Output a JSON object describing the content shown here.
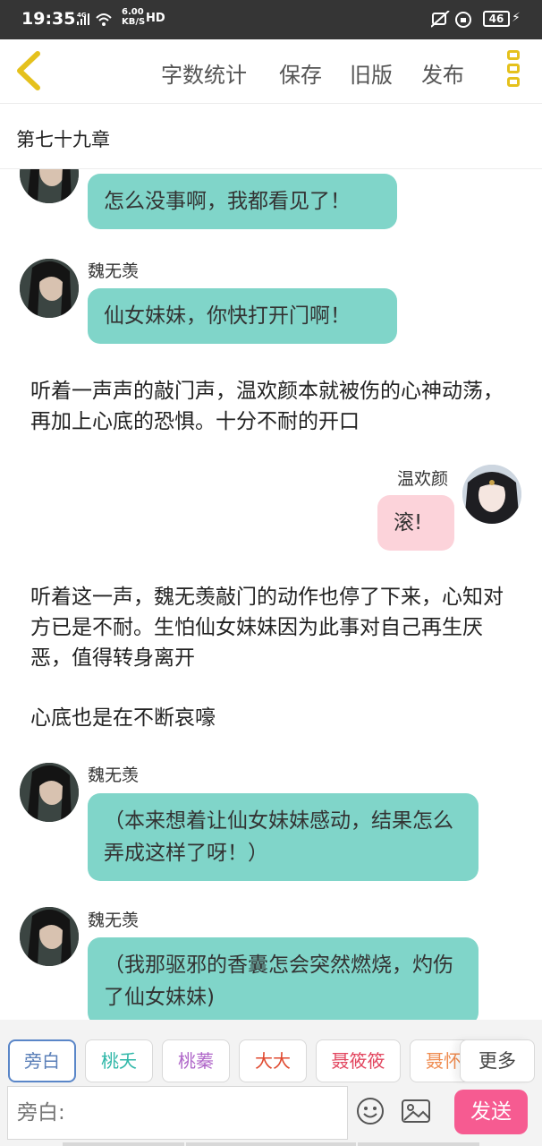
{
  "status_bar": {
    "time": "19:35",
    "network": "4G",
    "speed_value": "6.00",
    "speed_unit": "KB/S",
    "hd": "HD",
    "battery": "46"
  },
  "toolbar": {
    "word_count": "字数统计",
    "save": "保存",
    "old_version": "旧版",
    "publish": "发布"
  },
  "chapter": {
    "title": "第七十九章"
  },
  "messages": [
    {
      "type": "dialog",
      "side": "left",
      "speaker": "",
      "text": "怎么没事啊，我都看见了！"
    },
    {
      "type": "dialog",
      "side": "left",
      "speaker": "魏无羡",
      "text": "仙女妹妹，你快打开门啊！"
    },
    {
      "type": "narration",
      "text": "听着一声声的敲门声，温欢颜本就被伤的心神动荡，再加上心底的恐惧。十分不耐的开口"
    },
    {
      "type": "dialog",
      "side": "right",
      "speaker": "温欢颜",
      "text": "滚!"
    },
    {
      "type": "narration",
      "text": "听着这一声，魏无羡敲门的动作也停了下来，心知对方已是不耐。生怕仙女妹妹因为此事对自己再生厌恶，值得转身离开"
    },
    {
      "type": "narration",
      "text": "心底也是在不断哀嚎"
    },
    {
      "type": "dialog",
      "side": "left",
      "speaker": "魏无羡",
      "text": "（本来想着让仙女妹妹感动，结果怎么弄成这样了呀！）"
    },
    {
      "type": "dialog",
      "side": "left",
      "speaker": "魏无羡",
      "text": "（我那驱邪的香囊怎会突然燃烧，灼伤了仙女妹妹)"
    }
  ],
  "role_tags": [
    {
      "label": "旁白",
      "color": "#5a7fb8"
    },
    {
      "label": "桃夭",
      "color": "#2fb7a8"
    },
    {
      "label": "桃蓁",
      "color": "#b067c9"
    },
    {
      "label": "大大",
      "color": "#e0492f"
    },
    {
      "label": "聂筱筱",
      "color": "#e2455e"
    },
    {
      "label": "聂怀",
      "color": "#ef8b4f"
    }
  ],
  "more_label": "更多",
  "input": {
    "placeholder": "旁白:"
  },
  "send_label": "发送",
  "icons": {
    "back": "back-arrow-icon",
    "menu": "more-vertical-icon",
    "emoji": "emoji-icon",
    "image": "image-icon"
  }
}
